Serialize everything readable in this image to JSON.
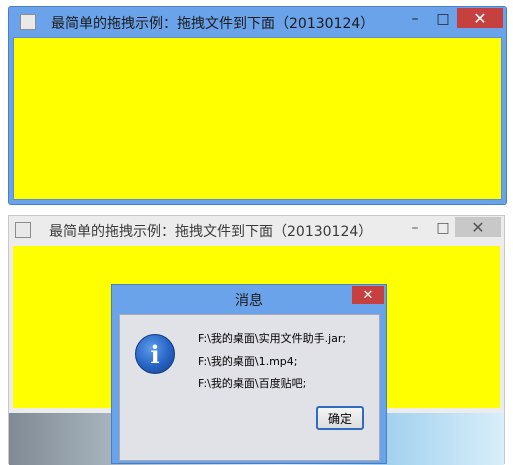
{
  "window1": {
    "title": "最简单的拖拽示例：拖拽文件到下面（20130124）",
    "minimize_glyph": "–",
    "maximize_glyph": "□",
    "close_glyph": "✕",
    "content_color": "#ffff00",
    "frame_color": "#6ba3ea"
  },
  "window2": {
    "title": "最简单的拖拽示例：拖拽文件到下面（20130124）",
    "minimize_glyph": "–",
    "maximize_glyph": "□",
    "close_glyph": "✕"
  },
  "dialog": {
    "title": "消息",
    "close_glyph": "✕",
    "icon_glyph": "i",
    "lines": [
      "F:\\我的桌面\\实用文件助手.jar;",
      "F:\\我的桌面\\1.mp4;",
      "F:\\我的桌面\\百度贴吧;"
    ],
    "ok_label": "确定"
  },
  "colors": {
    "accent_frame": "#6ba3ea",
    "close_red": "#c74040",
    "content_yellow": "#ffff00"
  }
}
